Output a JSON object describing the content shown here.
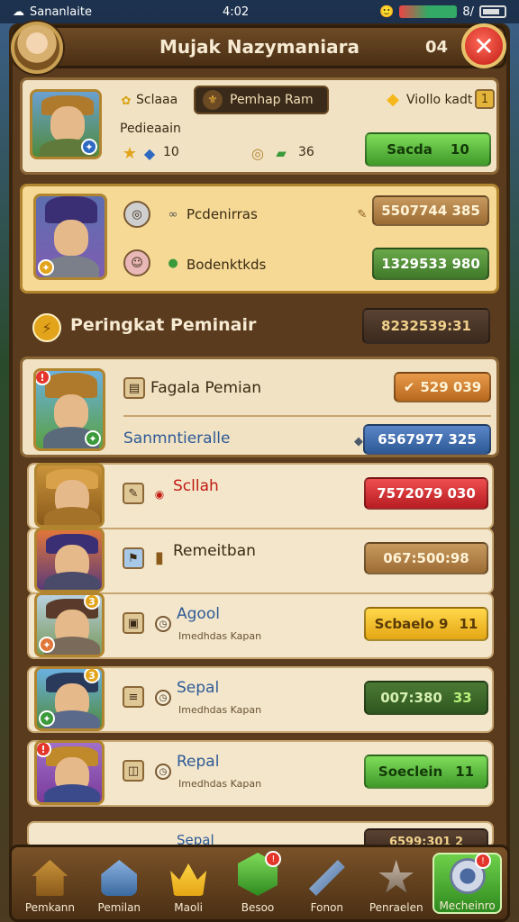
{
  "status": {
    "left_text": "Sananlaite",
    "time": "4:02",
    "battery_text": "8/"
  },
  "header": {
    "title": "Mujak Nazymaniara",
    "count": "04"
  },
  "profile": {
    "name": "Pedieaain",
    "pill_label_1": "Sclaaa",
    "pill_label_2": "Pemhap Ram",
    "right_label": "Viollo kadt",
    "stat_stars": "10",
    "stat_gems": "36",
    "action_label": "Sacda",
    "action_value": "10"
  },
  "featured": {
    "row1_label": "Pcdenirras",
    "row1_value": "5507744 385",
    "row2_label": "Bodenktkds",
    "row2_value": "1329533 980"
  },
  "section": {
    "title": "Peringkat Peminair",
    "value": "8232539:31"
  },
  "top_entry": {
    "label": "Fagala Pemian",
    "value_1": "529 039",
    "subtitle": "Sanmntieralle",
    "value_2": "6567977 325"
  },
  "rows": [
    {
      "name": "Scllah",
      "sub": "",
      "value": "7572079 030",
      "btn_color": "red"
    },
    {
      "name": "Remeitban",
      "sub": "",
      "value": "067:500:98",
      "btn_color": "tan"
    },
    {
      "name": "Agool",
      "sub": "Imedhdas Kapan",
      "value": "Scbaelo 9",
      "value_suffix": "11",
      "btn_color": "yellow"
    },
    {
      "name": "Sepal",
      "sub": "Imedhdas Kapan",
      "value": "007:380",
      "value_suffix": "33",
      "btn_color": "darkgreen"
    },
    {
      "name": "Repal",
      "sub": "Imedhdas Kapan",
      "value": "Soeclein",
      "value_suffix": "11",
      "btn_color": "green"
    },
    {
      "name": "Sepal",
      "sub": "",
      "value": "6599:301 2"
    }
  ],
  "tabs": [
    {
      "label": "Pemkann",
      "icon": "home-icon"
    },
    {
      "label": "Pemilan",
      "icon": "building-icon"
    },
    {
      "label": "Maoli",
      "icon": "crown-icon"
    },
    {
      "label": "Besoo",
      "icon": "gem-icon",
      "notif": "!"
    },
    {
      "label": "Fonon",
      "icon": "sword-icon"
    },
    {
      "label": "Penraelen",
      "icon": "star-icon"
    },
    {
      "label": "Mecheinro",
      "icon": "gear-icon",
      "notif": "!"
    }
  ]
}
